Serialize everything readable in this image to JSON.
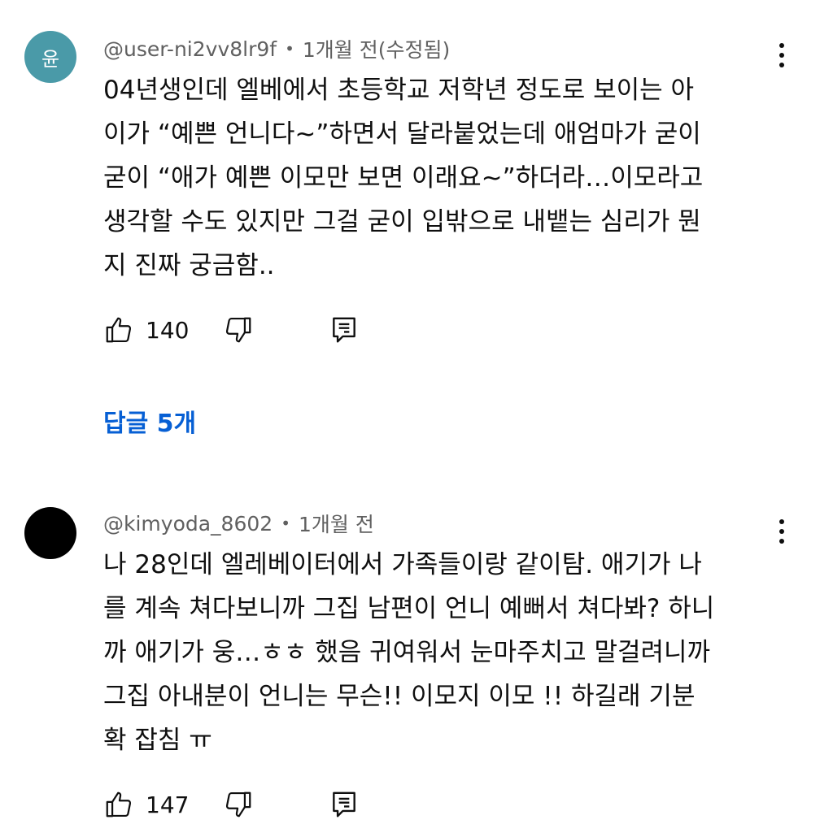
{
  "comments": [
    {
      "avatar_letter": "윤",
      "avatar_color": "#4a9aa8",
      "author": "@user-ni2vv8lr9f",
      "separator": "•",
      "time": "1개월 전(수정됨)",
      "text_lines": [
        "04년생인데 엘베에서 초등학교 저학년 정도로 보이는 아",
        "이가 “예쁜 언니다~”하면서 달라붙었는데 애엄마가 굳이",
        "굳이 “애가 예쁜 이모만 보면 이래요~”하더라…이모라고",
        "생각할 수도 있지만 그걸 굳이 입밖으로 내뱉는 심리가 뭔",
        "지 진짜 궁금함.."
      ],
      "likes": "140",
      "like_icon": "thumbs-up-icon",
      "dislike_icon": "thumbs-down-icon",
      "reply_icon": "reply-icon",
      "menu_icon": "more-vert-icon",
      "replies_label": "답글 5개"
    },
    {
      "avatar_color": "#000000",
      "author": "@kimyoda_8602",
      "separator": "•",
      "time": "1개월 전",
      "text_lines": [
        "나 28인데 엘레베이터에서 가족들이랑 같이탐. 애기가 나",
        "를 계속 쳐다보니까 그집 남편이 언니 예뻐서 쳐다봐? 하니",
        "까 애기가 웅…ㅎㅎ 했음 귀여워서 눈마주치고 말걸려니까",
        "그집 아내분이 언니는 무슨!! 이모지 이모 !! 하길래 기분",
        "확 잡침 ㅠ"
      ],
      "likes": "147",
      "like_icon": "thumbs-up-icon",
      "dislike_icon": "thumbs-down-icon",
      "reply_icon": "reply-icon",
      "menu_icon": "more-vert-icon"
    }
  ],
  "colors": {
    "replies_link": "#065fd4",
    "meta_text": "#606060",
    "body_text": "#0f0f0f"
  }
}
